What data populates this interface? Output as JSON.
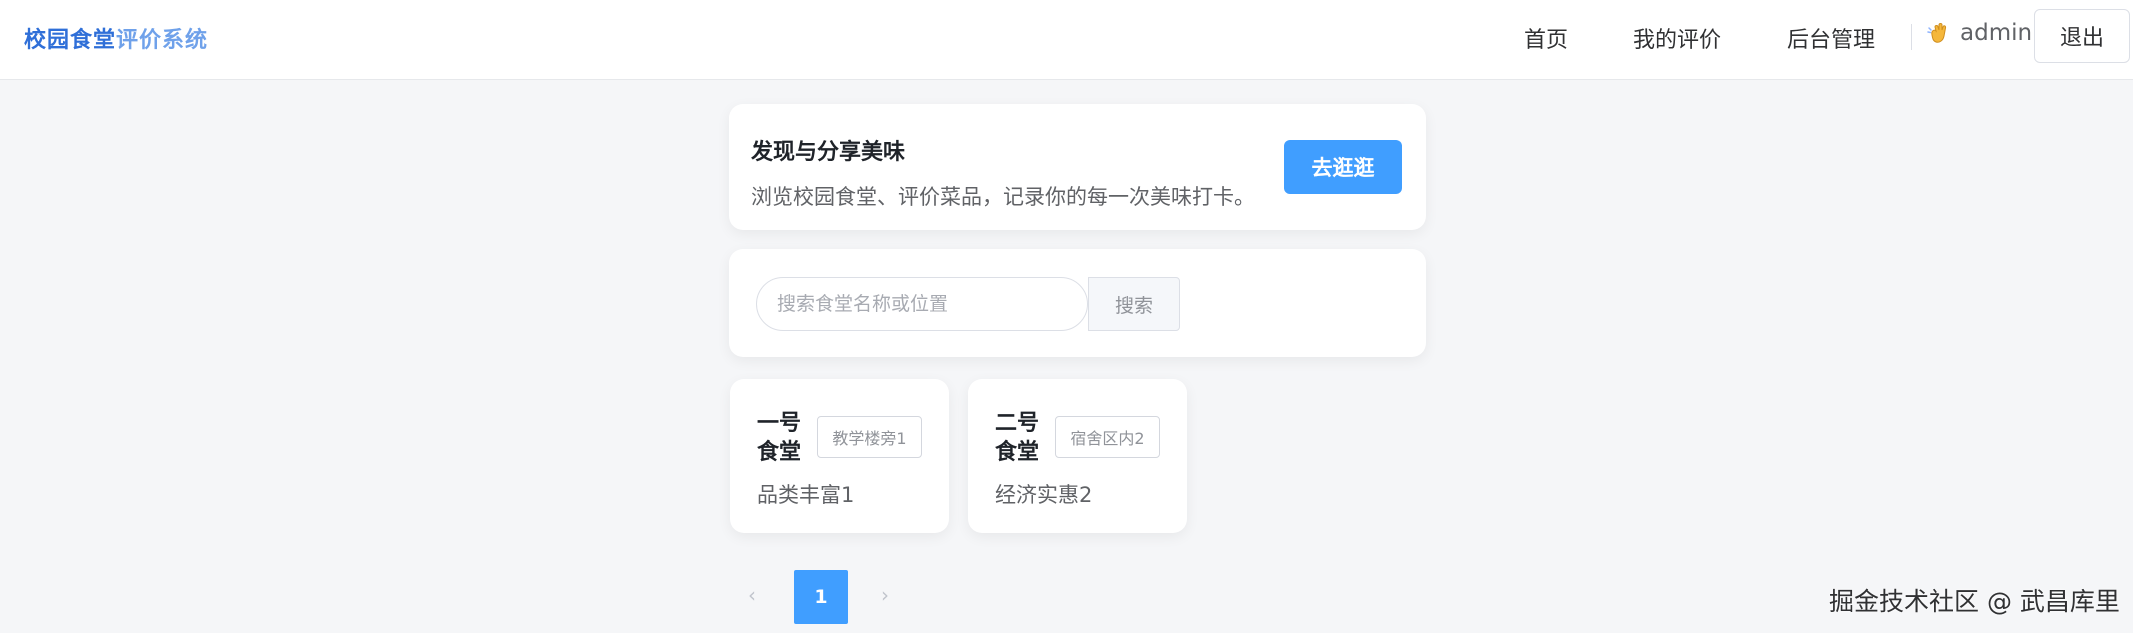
{
  "header": {
    "brand_part1": "校园食堂",
    "brand_part2": "评价系统",
    "nav": [
      "首页",
      "我的评价",
      "后台管理"
    ],
    "username": "admin",
    "logout_label": "退出"
  },
  "hero": {
    "title": "发现与分享美味",
    "subtitle": "浏览校园食堂、评价菜品，记录你的每一次美味打卡。",
    "button_label": "去逛逛"
  },
  "search": {
    "placeholder": "搜索食堂名称或位置",
    "value": "",
    "button_label": "搜索"
  },
  "canteens": [
    {
      "name": "一号食堂",
      "location": "教学楼旁1",
      "description": "品类丰富1"
    },
    {
      "name": "二号食堂",
      "location": "宿舍区内2",
      "description": "经济实惠2"
    }
  ],
  "pagination": {
    "prev_icon": "chevron-left-icon",
    "current_page": "1",
    "next_icon": "chevron-right-icon"
  },
  "watermark": "掘金技术社区 @ 武昌库里",
  "colors": {
    "primary": "#409eff",
    "brand": "#2f6fd8",
    "background": "#f5f6f8"
  }
}
